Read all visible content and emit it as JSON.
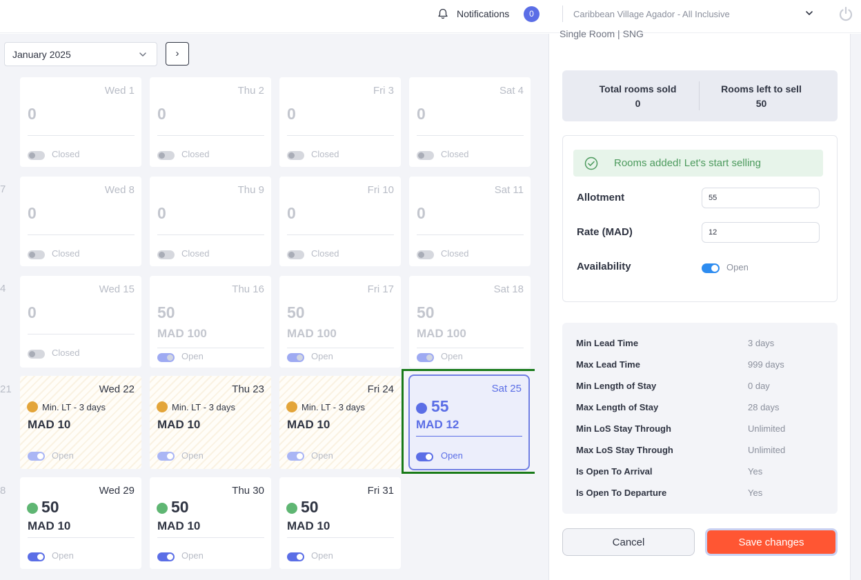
{
  "topbar": {
    "notifications_label": "Notifications",
    "notifications_count": "0",
    "hotel_name": "Caribbean Village Agador - All Inclusive"
  },
  "calendar": {
    "month": "January 2025",
    "next_glyph": "›",
    "edge_numbers": [
      "7",
      "4",
      "21",
      "8"
    ],
    "closed_cells": [
      {
        "date": "Wed 1",
        "value": "0",
        "status": "Closed"
      },
      {
        "date": "Thu 2",
        "value": "0",
        "status": "Closed"
      },
      {
        "date": "Fri 3",
        "value": "0",
        "status": "Closed"
      },
      {
        "date": "Sat 4",
        "value": "0",
        "status": "Closed"
      },
      {
        "date": "Wed 8",
        "value": "0",
        "status": "Closed"
      },
      {
        "date": "Thu 9",
        "value": "0",
        "status": "Closed"
      },
      {
        "date": "Fri 10",
        "value": "0",
        "status": "Closed"
      },
      {
        "date": "Sat 11",
        "value": "0",
        "status": "Closed"
      },
      {
        "date": "Wed 15",
        "value": "0",
        "status": "Closed"
      }
    ],
    "faded_open_cells": [
      {
        "date": "Thu 16",
        "value": "50",
        "rate": "MAD 100",
        "status": "Open"
      },
      {
        "date": "Fri 17",
        "value": "50",
        "rate": "MAD 100",
        "status": "Open"
      },
      {
        "date": "Sat 18",
        "value": "50",
        "rate": "MAD 100",
        "status": "Open"
      }
    ],
    "restricted_cells": [
      {
        "date": "Wed 22",
        "restriction": "Min. LT - 3 days",
        "rate": "MAD 10",
        "status": "Open"
      },
      {
        "date": "Thu 23",
        "restriction": "Min. LT - 3 days",
        "rate": "MAD 10",
        "status": "Open"
      },
      {
        "date": "Fri 24",
        "restriction": "Min. LT - 3 days",
        "rate": "MAD 10",
        "status": "Open"
      }
    ],
    "active_cell": {
      "date": "Sat 25",
      "value": "55",
      "rate": "MAD 12",
      "status": "Open"
    },
    "open_cells": [
      {
        "date": "Wed 29",
        "value": "50",
        "rate": "MAD 10",
        "status": "Open"
      },
      {
        "date": "Thu 30",
        "value": "50",
        "rate": "MAD 10",
        "status": "Open"
      },
      {
        "date": "Fri 31",
        "value": "50",
        "rate": "MAD 10",
        "status": "Open"
      }
    ]
  },
  "panel": {
    "room_title": "Single Room | SNG",
    "summary": {
      "sold_label": "Total rooms sold",
      "sold_value": "0",
      "left_label": "Rooms left to sell",
      "left_value": "50"
    },
    "success_message": "Rooms added! Let's start selling",
    "allotment_label": "Allotment",
    "allotment_value": "55",
    "rate_label": "Rate (MAD)",
    "rate_value": "12",
    "availability_label": "Availability",
    "availability_value": "Open",
    "restrictions": [
      {
        "label": "Min Lead Time",
        "value": "3 days"
      },
      {
        "label": "Max Lead Time",
        "value": "999 days"
      },
      {
        "label": "Min Length of Stay",
        "value": "0 day"
      },
      {
        "label": "Max Length of Stay",
        "value": "28 days"
      },
      {
        "label": "Min LoS Stay Through",
        "value": "Unlimited"
      },
      {
        "label": "Max LoS Stay Through",
        "value": "Unlimited"
      },
      {
        "label": "Is Open To Arrival",
        "value": "Yes"
      },
      {
        "label": "Is Open To Departure",
        "value": "Yes"
      }
    ],
    "cancel_label": "Cancel",
    "save_label": "Save changes"
  },
  "colors": {
    "accent": "#5b6ee6",
    "save": "#ff5633",
    "success": "#4c9a5d",
    "restriction_dot": "#e3a53a",
    "open_dot": "#5fb673",
    "highlight_outline": "#187a18"
  }
}
